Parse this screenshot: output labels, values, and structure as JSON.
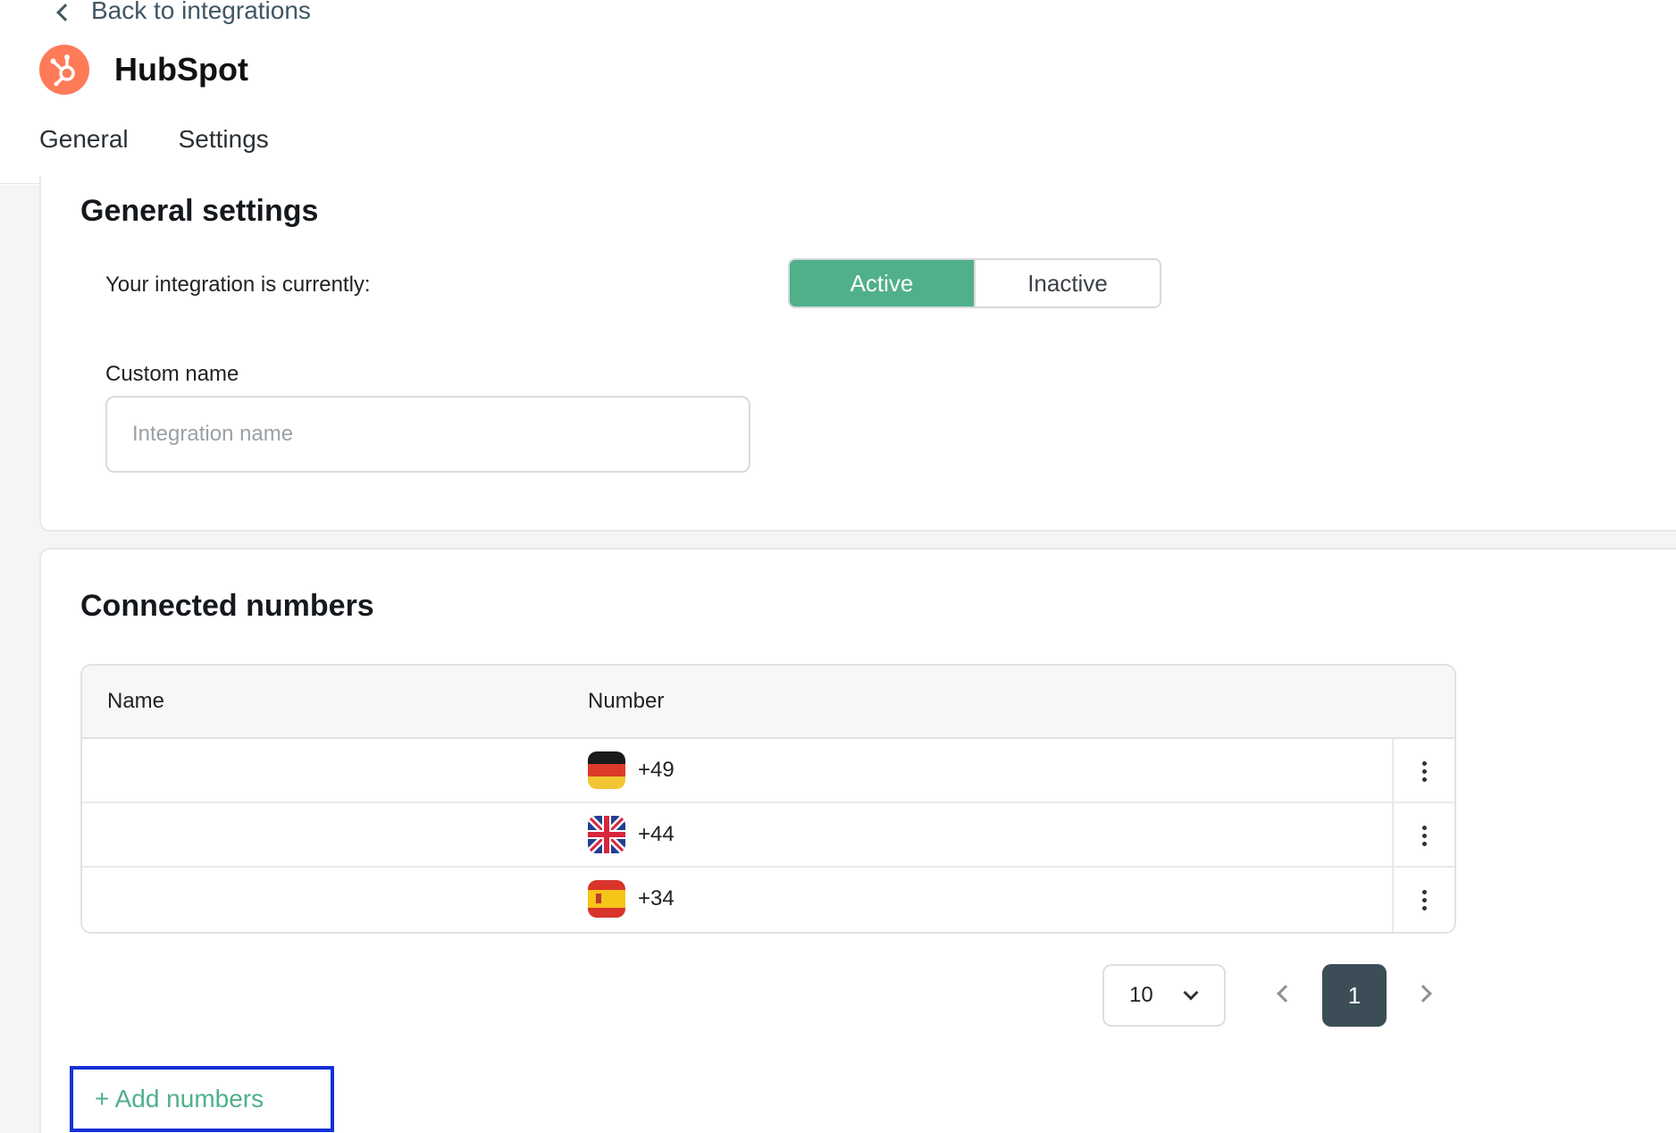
{
  "header": {
    "back_label": "Back to integrations",
    "app_name": "HubSpot",
    "brand_color": "#ff7a59",
    "tabs": [
      {
        "label": "General",
        "active": true
      },
      {
        "label": "Settings",
        "active": false
      }
    ]
  },
  "general": {
    "title": "General settings",
    "status_label": "Your integration is currently:",
    "status_options": {
      "active": "Active",
      "inactive": "Inactive"
    },
    "selected_status": "Active",
    "custom_name_label": "Custom name",
    "custom_name_value": "",
    "custom_name_placeholder": "Integration name"
  },
  "connected": {
    "title": "Connected numbers",
    "columns": {
      "name": "Name",
      "number": "Number"
    },
    "rows": [
      {
        "name": "",
        "country": "DE",
        "flag_icon": "germany-flag-icon",
        "number": "+49"
      },
      {
        "name": "",
        "country": "GB",
        "flag_icon": "uk-flag-icon",
        "number": "+44"
      },
      {
        "name": "",
        "country": "ES",
        "flag_icon": "spain-flag-icon",
        "number": "+34"
      }
    ],
    "pagination": {
      "page_size": "10",
      "current_page": "1"
    },
    "add_label": "+ Add numbers"
  },
  "colors": {
    "accent_green": "#4fb08a",
    "pagination_active": "#3d4d57",
    "highlight_box": "#1530d9"
  }
}
